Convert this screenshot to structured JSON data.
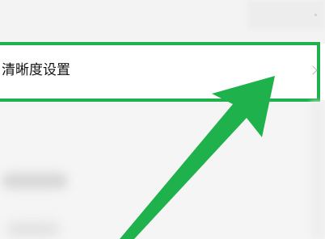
{
  "setting": {
    "label": "清晰度设置"
  },
  "icons": {
    "chevron": "chevron-right-icon",
    "arrow": "green-arrow-annotation"
  },
  "colors": {
    "highlight": "#1fb14c",
    "arrow": "#1fb14c",
    "background": "#f4f4f4",
    "row": "#ffffff"
  }
}
